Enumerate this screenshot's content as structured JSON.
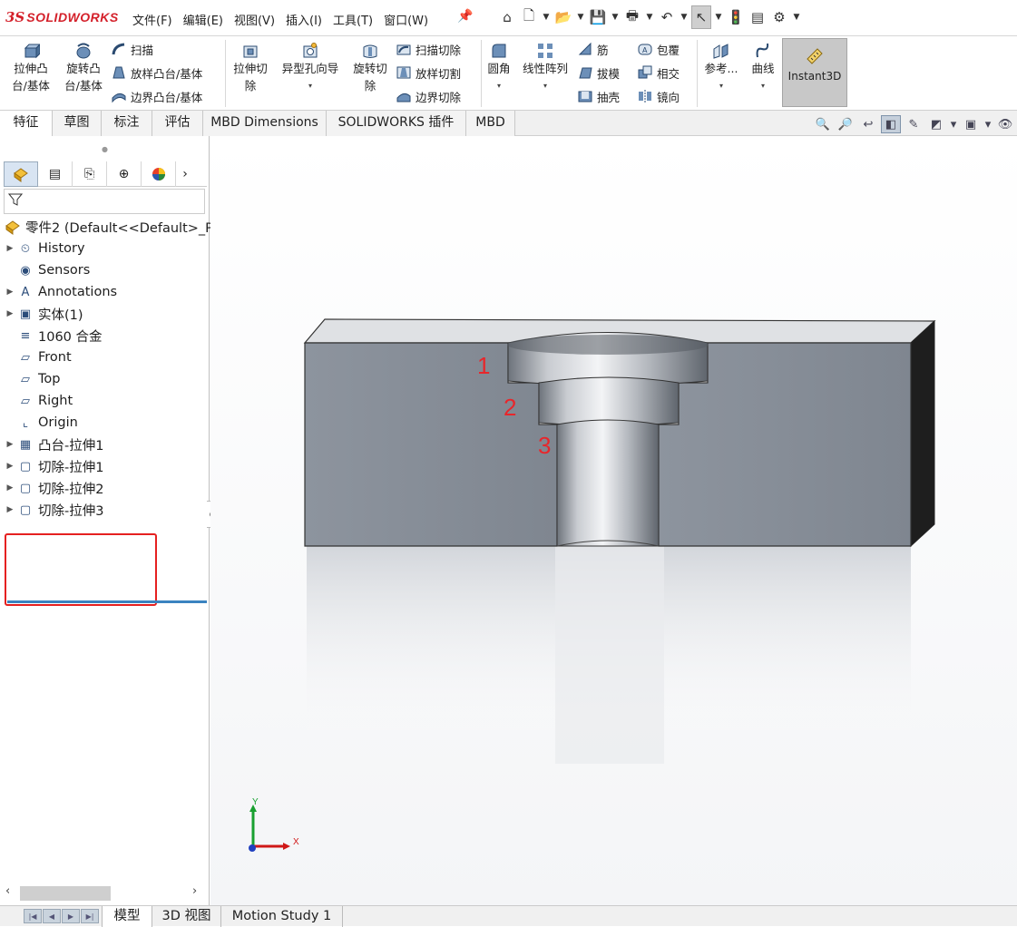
{
  "app": {
    "logo_ds": "3S",
    "logo_text": "SOLIDWORKS"
  },
  "menu": [
    "文件(F)",
    "编辑(E)",
    "视图(V)",
    "插入(I)",
    "工具(T)",
    "窗口(W)"
  ],
  "quick_icons": [
    "home-icon",
    "new-document-icon",
    "open-icon",
    "save-icon",
    "print-icon",
    "undo-icon",
    "select-pointer-icon",
    "traffic-light-icon",
    "file-properties-icon",
    "gear-icon"
  ],
  "ribbon": {
    "extrude_boss": [
      "拉伸凸",
      "台/基体"
    ],
    "revolve_boss": [
      "旋转凸",
      "台/基体"
    ],
    "sweep": "扫描",
    "loft": "放样凸台/基体",
    "boundary": "边界凸台/基体",
    "extrude_cut": [
      "拉伸切",
      "除"
    ],
    "hole_wizard": "异型孔向导",
    "revolve_cut": [
      "旋转切",
      "除"
    ],
    "sweep_cut": "扫描切除",
    "loft_cut": "放样切割",
    "boundary_cut": "边界切除",
    "fillet": "圆角",
    "linear_pattern": "线性阵列",
    "rib": "筋",
    "draft": "拔模",
    "shell": "抽壳",
    "wrap": "包覆",
    "intersect": "相交",
    "mirror": "镜向",
    "reference": "参考...",
    "curves": "曲线",
    "instant3d": "Instant3D"
  },
  "tabs": [
    "特征",
    "草图",
    "标注",
    "评估",
    "MBD Dimensions",
    "SOLIDWORKS 插件",
    "MBD"
  ],
  "tree": {
    "root": "零件2 (Default<<Default>_P",
    "items": [
      {
        "label": "History",
        "expand": true,
        "icon": "history-folder-icon"
      },
      {
        "label": "Sensors",
        "expand": false,
        "icon": "sensors-icon"
      },
      {
        "label": "Annotations",
        "expand": true,
        "icon": "annotations-icon"
      },
      {
        "label": "实体(1)",
        "expand": true,
        "icon": "solid-bodies-icon"
      },
      {
        "label": "1060 合金",
        "expand": false,
        "icon": "material-icon"
      },
      {
        "label": "Front",
        "expand": false,
        "icon": "plane-icon"
      },
      {
        "label": "Top",
        "expand": false,
        "icon": "plane-icon"
      },
      {
        "label": "Right",
        "expand": false,
        "icon": "plane-icon"
      },
      {
        "label": "Origin",
        "expand": false,
        "icon": "origin-icon"
      },
      {
        "label": "凸台-拉伸1",
        "expand": true,
        "icon": "extrude-boss-icon"
      },
      {
        "label": "切除-拉伸1",
        "expand": true,
        "icon": "extrude-cut-icon"
      },
      {
        "label": "切除-拉伸2",
        "expand": true,
        "icon": "extrude-cut-icon"
      },
      {
        "label": "切除-拉伸3",
        "expand": true,
        "icon": "extrude-cut-icon"
      }
    ]
  },
  "bottom_tabs": [
    "模型",
    "3D 视图",
    "Motion Study 1"
  ],
  "viewport": {
    "step_labels": [
      "1",
      "2",
      "3"
    ],
    "triad": {
      "x": "X",
      "y": "Y"
    },
    "colors": {
      "label": "#e8262b",
      "box": "#e52020",
      "part": "#8c949f"
    }
  }
}
